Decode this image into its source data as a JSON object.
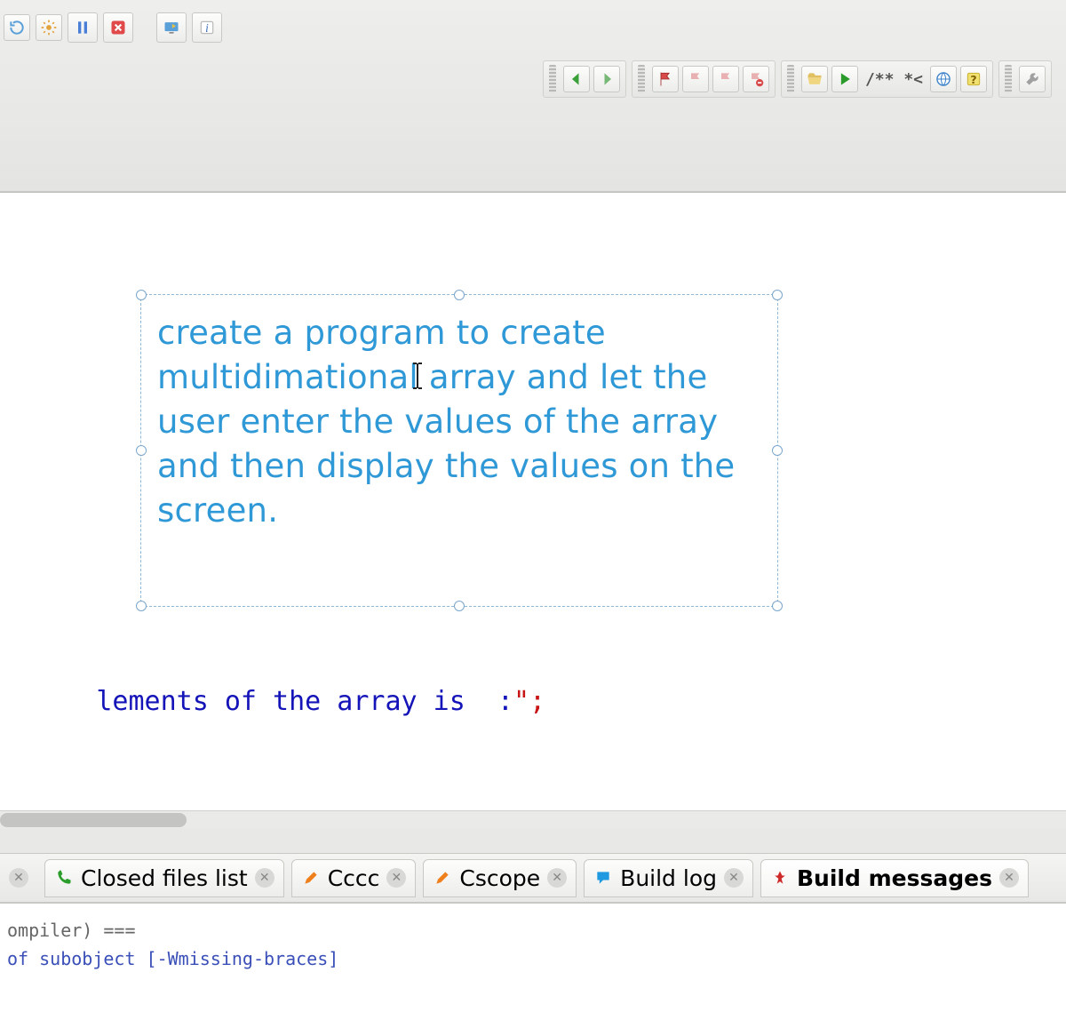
{
  "toolbar": {
    "row1": {
      "refresh_label": "↻",
      "pause_label": "⏸",
      "stop_label": "✖",
      "debug_label": "⚑",
      "info_label": "i"
    },
    "row2": {
      "doc_comment_label": "/** *<",
      "back_label": "←",
      "fwd_label": "→"
    }
  },
  "editor": {
    "textbox_text": "create a program to create multidimational array and let the user enter the values of the array and then display the values on the screen.",
    "code_fragment": {
      "ident": "lements of the array is  :",
      "tail": "\";"
    }
  },
  "bottom_tabs": {
    "items": [
      {
        "label": "Closed files list",
        "icon": "phone-icon",
        "color": "#2a9d2a"
      },
      {
        "label": "Cccc",
        "icon": "pencil-icon",
        "color": "#ef7f1a"
      },
      {
        "label": "Cscope",
        "icon": "pencil-icon",
        "color": "#ef7f1a"
      },
      {
        "label": "Build log",
        "icon": "chat-icon",
        "color": "#1f9ae0"
      },
      {
        "label": "Build messages",
        "icon": "pin-icon",
        "color": "#cf2a2a",
        "active": true
      }
    ]
  },
  "compiler": {
    "line1": "ompiler) ===",
    "line2": "of subobject [-Wmissing-braces]"
  }
}
